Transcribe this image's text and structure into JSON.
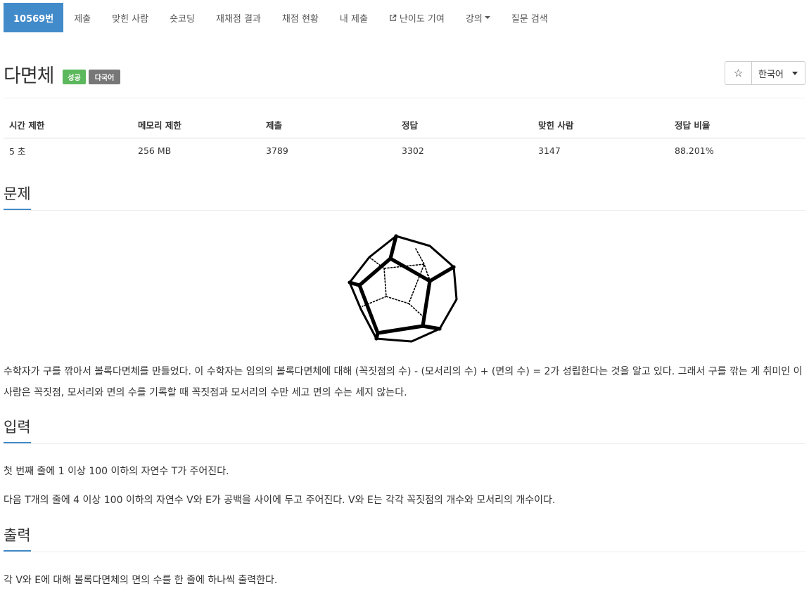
{
  "nav": {
    "items": [
      {
        "label": "10569번"
      },
      {
        "label": "제출"
      },
      {
        "label": "맞힌 사람"
      },
      {
        "label": "숏코딩"
      },
      {
        "label": "재채점 결과"
      },
      {
        "label": "채점 현황"
      },
      {
        "label": "내 제출"
      },
      {
        "label": "난이도 기여",
        "icon": "external-link-icon"
      },
      {
        "label": "강의",
        "icon": "caret-down-icon"
      },
      {
        "label": "질문 검색"
      }
    ]
  },
  "header": {
    "title": "다면체",
    "badges": {
      "success": "성공",
      "multilang": "다국어"
    },
    "star_icon": "☆",
    "language": "한국어"
  },
  "info": {
    "headers": [
      "시간 제한",
      "메모리 제한",
      "제출",
      "정답",
      "맞힌 사람",
      "정답 비율"
    ],
    "values": [
      "5 초",
      "256 MB",
      "3789",
      "3302",
      "3147",
      "88.201%"
    ]
  },
  "sections": {
    "problem": {
      "title": "문제",
      "text": "수학자가 구를 깎아서 볼록다면체를 만들었다. 이 수학자는 임의의 볼록다면체에 대해 (꼭짓점의 수) - (모서리의 수) + (면의 수) = 2가 성립한다는 것을 알고 있다. 그래서 구를 깎는 게 취미인 이 사람은 꼭짓점, 모서리와 면의 수를 기록할 때 꼭짓점과 모서리의 수만 세고 면의 수는 세지 않는다."
    },
    "input": {
      "title": "입력",
      "line1": "첫 번째 줄에 1 이상 100 이하의 자연수 T가 주어진다.",
      "line2": "다음 T개의 줄에 4 이상 100 이하의 자연수 V와 E가 공백을 사이에 두고 주어진다. V와 E는 각각 꼭짓점의 개수와 모서리의 개수이다."
    },
    "output": {
      "title": "출력",
      "text": "각 V와 E에 대해 볼록다면체의 면의 수를 한 줄에 하나씩 출력한다."
    }
  },
  "colors": {
    "accent": "#428bca",
    "success": "#5cb85c",
    "muted_badge": "#777777"
  }
}
